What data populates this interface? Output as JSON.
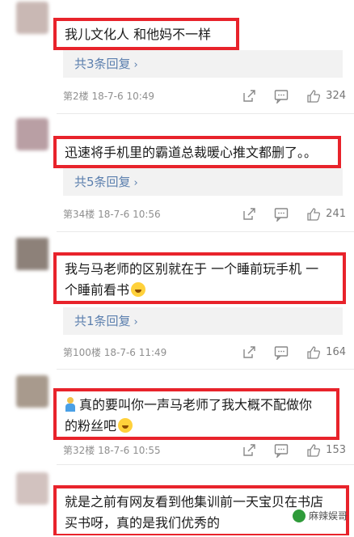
{
  "comments": [
    {
      "text": "我儿文化人 和他妈不一样",
      "reply": "共3条回复",
      "floor": "第2楼 18-7-6 10:49",
      "likes": "324",
      "avatar_color": "#c9b8b4"
    },
    {
      "text": "迅速将手机里的霸道总裁暖心推文都删了。。",
      "reply": "共5条回复",
      "floor": "第34楼 18-7-6 10:56",
      "likes": "241",
      "avatar_color": "#b99fa4"
    },
    {
      "line1": "我与马老师的区别就在于 一个睡前玩手机 一",
      "line2": "个睡前看书",
      "reply": "共1条回复",
      "floor": "第100楼 18-7-6 11:49",
      "likes": "164",
      "avatar_color": "#8d8179"
    },
    {
      "line1": "真的要叫你一声马老师了我大概不配做你",
      "line2": "的粉丝吧",
      "floor": "第32楼 18-7-6 10:55",
      "likes": "153",
      "avatar_color": "#a89a8d"
    },
    {
      "line1": "就是之前有网友看到他集训前一天宝贝在书店",
      "line2": "买书呀，真的是我们优秀的",
      "avatar_color": "#d2c2bf"
    }
  ],
  "watermark": "麻辣娱哥",
  "icons": {
    "share": "share-icon",
    "comment": "comment-icon",
    "like": "thumbs-up-icon",
    "emoji": "laughing-emoji",
    "person": "person-emoji",
    "chevron": "chevron-right-icon"
  },
  "colors": {
    "highlight_border": "#e8232b",
    "link": "#5b7fae"
  }
}
